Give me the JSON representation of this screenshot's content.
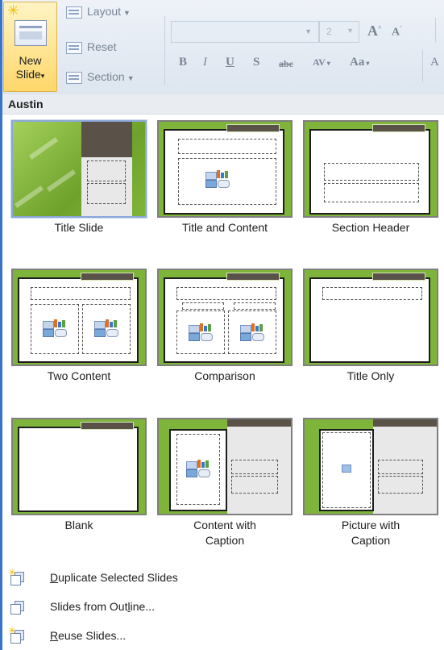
{
  "ribbon": {
    "new_slide_label_line1": "New",
    "new_slide_label_line2": "Slide",
    "new_slide_arrow": "▾",
    "layout_label": "Layout",
    "reset_label": "Reset",
    "section_label": "Section",
    "font_size_value": "2",
    "grow_font": "A",
    "shrink_font": "A",
    "bold": "B",
    "italic": "I",
    "underline": "U",
    "shadow": "S",
    "strikethrough": "abc",
    "char_spacing": "AV",
    "change_case": "Aa",
    "colors": {
      "ribbon_bg": "#dde5ef",
      "new_slide_bg": "#ffd76a"
    }
  },
  "theme_name": "Austin",
  "layouts": [
    {
      "label": "Title Slide",
      "selected": true
    },
    {
      "label": "Title and Content"
    },
    {
      "label": "Section Header"
    },
    {
      "label": "Two Content"
    },
    {
      "label": "Comparison"
    },
    {
      "label": "Title Only"
    },
    {
      "label": "Blank"
    },
    {
      "label_line1": "Content with",
      "label_line2": "Caption"
    },
    {
      "label_line1": "Picture with",
      "label_line2": "Caption"
    }
  ],
  "menu": [
    {
      "label_underlined": "D",
      "label_rest": "uplicate Selected Slides",
      "icon": "duplicate-slide-icon"
    },
    {
      "label_before": "Slides from Out",
      "label_underlined": "l",
      "label_after": "ine...",
      "icon": "slides-from-outline-icon"
    },
    {
      "label_underlined": "R",
      "label_rest": "euse Slides...",
      "icon": "reuse-slides-icon"
    }
  ],
  "colors": {
    "accent_green": "#7fb43a",
    "tab_brown": "#5a5248",
    "selection_blue": "#8aa8d8"
  }
}
